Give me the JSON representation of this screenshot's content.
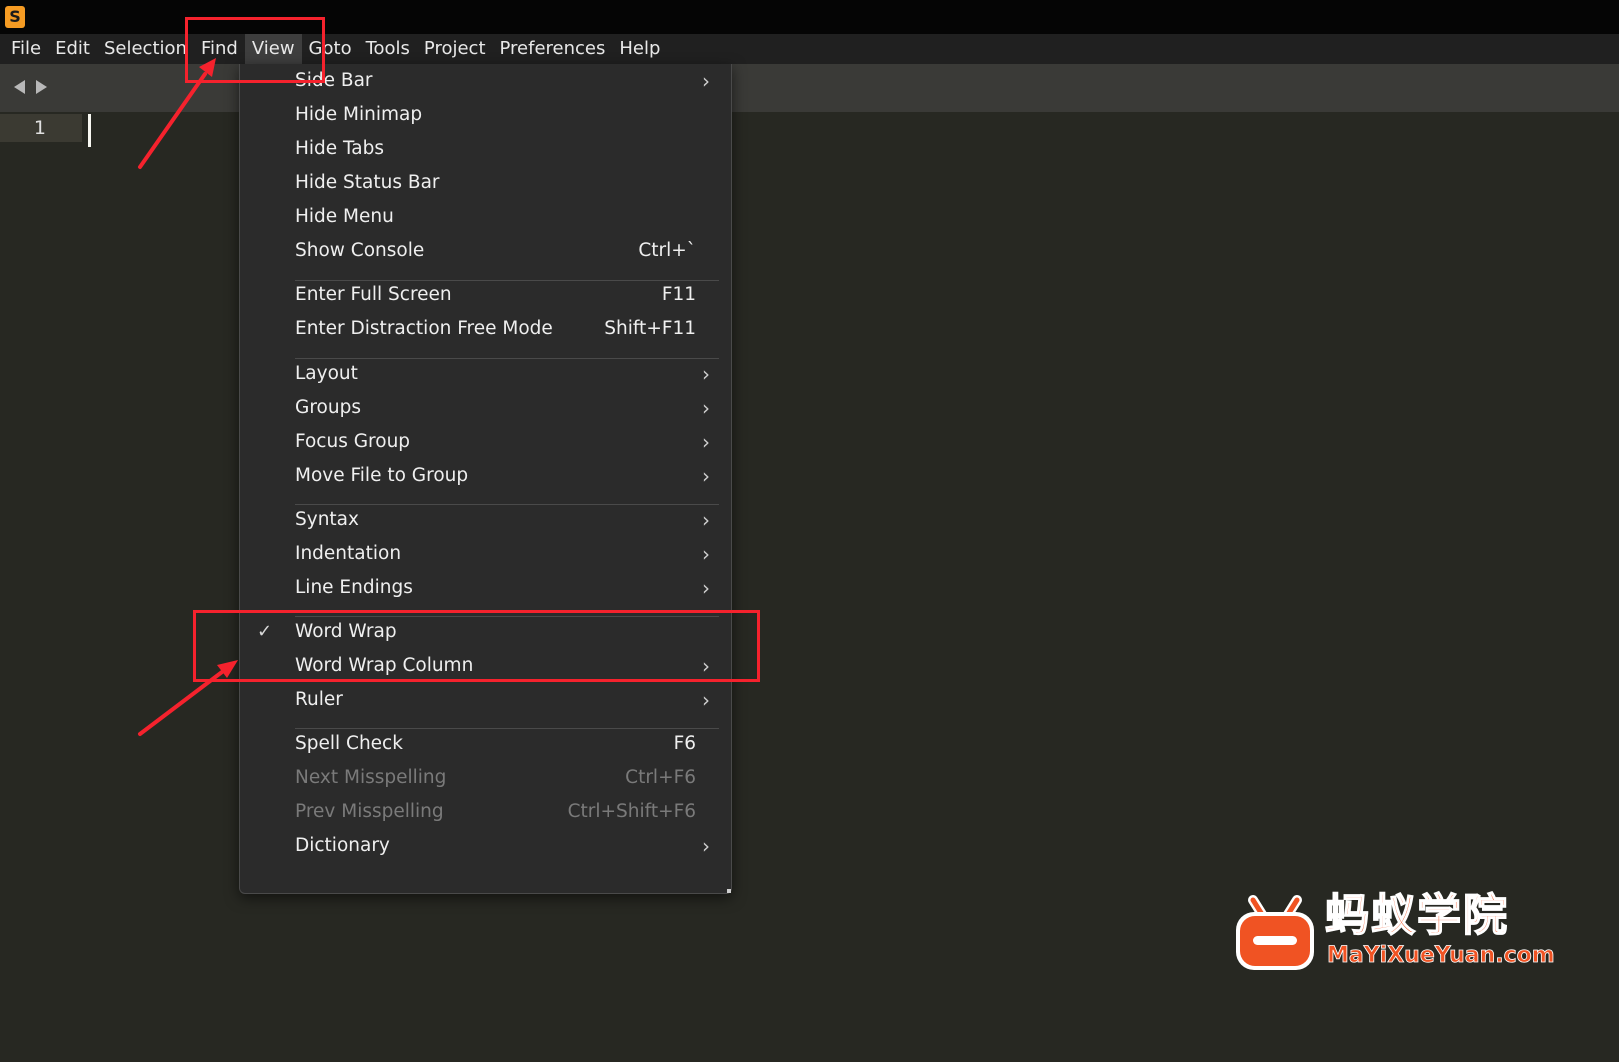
{
  "app": {
    "logo_letter": "S"
  },
  "menubar": {
    "items": [
      {
        "label": "File"
      },
      {
        "label": "Edit"
      },
      {
        "label": "Selection"
      },
      {
        "label": "Find"
      },
      {
        "label": "View"
      },
      {
        "label": "Goto"
      },
      {
        "label": "Tools"
      },
      {
        "label": "Project"
      },
      {
        "label": "Preferences"
      },
      {
        "label": "Help"
      }
    ],
    "active": "View"
  },
  "editor": {
    "line_number": "1"
  },
  "view_menu": {
    "items": [
      {
        "label": "Side Bar",
        "submenu": true
      },
      {
        "label": "Hide Minimap"
      },
      {
        "label": "Hide Tabs"
      },
      {
        "label": "Hide Status Bar"
      },
      {
        "label": "Hide Menu"
      },
      {
        "label": "Show Console",
        "shortcut": "Ctrl+`"
      },
      {
        "label": "Enter Full Screen",
        "shortcut": "F11"
      },
      {
        "label": "Enter Distraction Free Mode",
        "shortcut": "Shift+F11"
      },
      {
        "label": "Layout",
        "submenu": true
      },
      {
        "label": "Groups",
        "submenu": true
      },
      {
        "label": "Focus Group",
        "submenu": true
      },
      {
        "label": "Move File to Group",
        "submenu": true
      },
      {
        "label": "Syntax",
        "submenu": true
      },
      {
        "label": "Indentation",
        "submenu": true
      },
      {
        "label": "Line Endings",
        "submenu": true
      },
      {
        "label": "Word Wrap",
        "checked": true
      },
      {
        "label": "Word Wrap Column",
        "submenu": true
      },
      {
        "label": "Ruler",
        "submenu": true
      },
      {
        "label": "Spell Check",
        "shortcut": "F6"
      },
      {
        "label": "Next Misspelling",
        "shortcut": "Ctrl+F6",
        "disabled": true
      },
      {
        "label": "Prev Misspelling",
        "shortcut": "Ctrl+Shift+F6",
        "disabled": true
      },
      {
        "label": "Dictionary",
        "submenu": true
      }
    ],
    "glyphs": {
      "submenu_arrow": "›",
      "check": "✓"
    }
  },
  "watermark": {
    "title": "蚂蚁学院",
    "subtitle": "MaYiXueYuan.com"
  },
  "colors": {
    "menu_bg": "#2b2b2b",
    "editor_bg": "#272822",
    "annotation_red": "#f5222d",
    "watermark_orange": "#f05323"
  }
}
